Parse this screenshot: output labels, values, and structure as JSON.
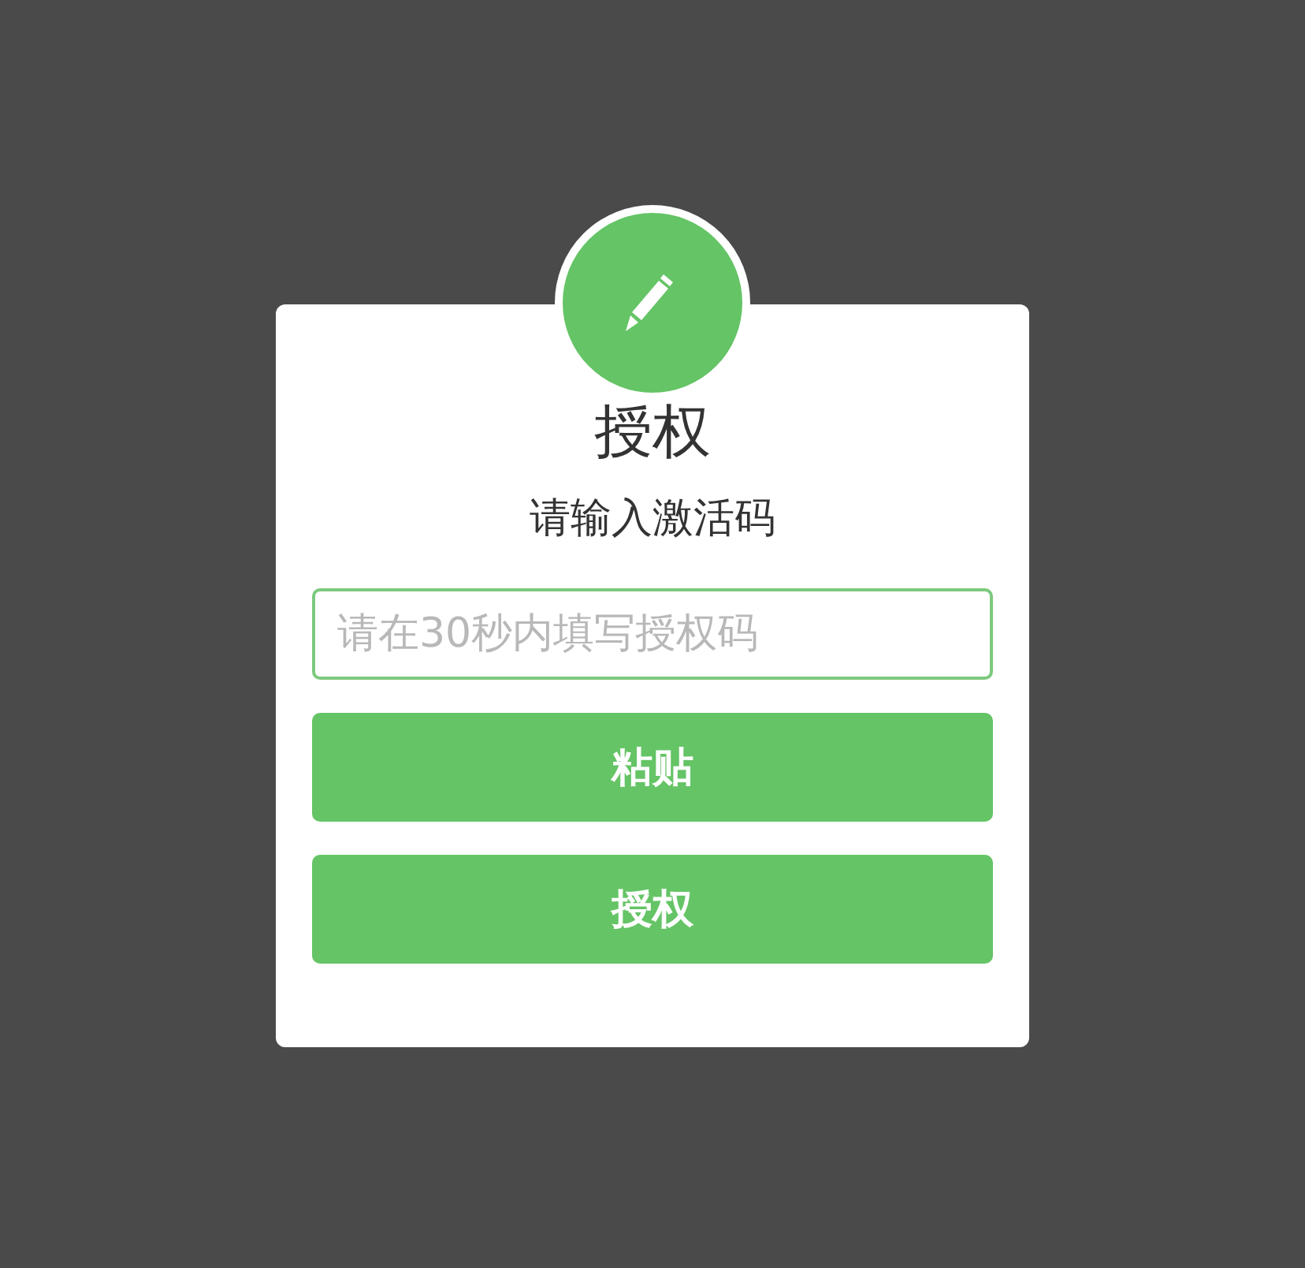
{
  "dialog": {
    "title": "授权",
    "subtitle": "请输入激活码",
    "code_field": {
      "placeholder": "请在30秒内填写授权码"
    },
    "buttons": [
      "粘贴",
      "授权"
    ]
  }
}
